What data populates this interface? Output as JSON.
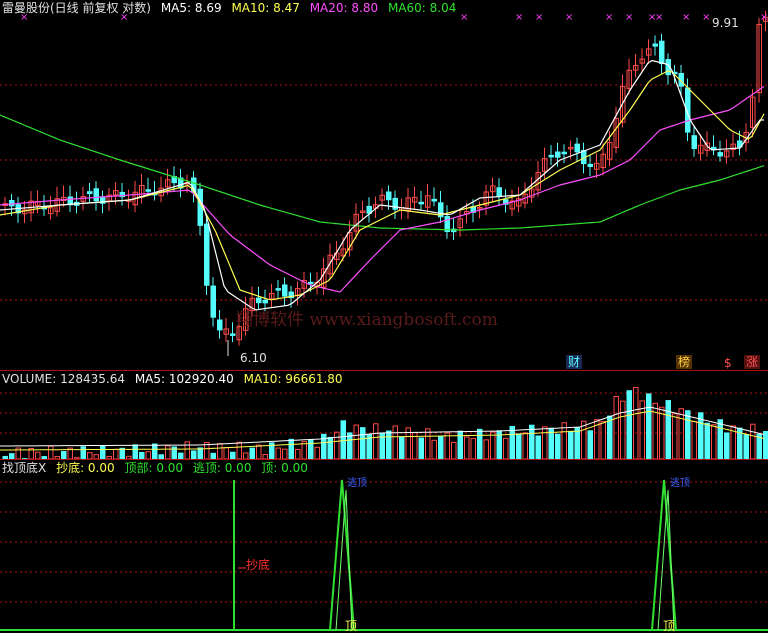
{
  "main": {
    "title": "雷曼股份(日线 前复权 对数)",
    "ma5": "MA5: 8.69",
    "ma10": "MA10: 8.47",
    "ma20": "MA20: 8.80",
    "ma60": "MA60: 8.04",
    "price_high": "9.91",
    "price_low": "6.10",
    "watermark": "翔博软件 www.xiangbosoft.com",
    "tag_cai": "财",
    "tag_bang": "榜",
    "tag_money": "$",
    "tag_zhang": "涨"
  },
  "volume": {
    "vol": "VOLUME: 128435.64",
    "ma5": "MA5: 102920.40",
    "ma10": "MA10: 96661.80"
  },
  "indicator": {
    "name": "找顶底X",
    "chaodi": "抄底: 0.00",
    "dingbu": "顶部: 0.00",
    "taoding": "逃顶: 0.00",
    "ding": "顶: 0.00",
    "label_chaodi": "抄底",
    "label_taoding": "逃顶",
    "label_ding": "顶"
  },
  "colors": {
    "up": "#ff4a4a",
    "down": "#54fcfc",
    "ma5": "#ffffff",
    "ma10": "#ffff50",
    "ma20": "#ff50ff",
    "ma60": "#30e030",
    "grid": "#b01010"
  }
}
